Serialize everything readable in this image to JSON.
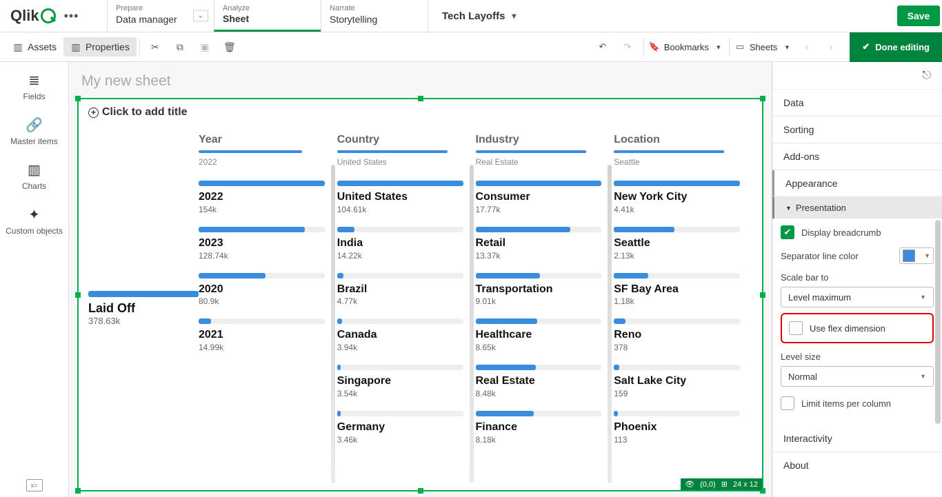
{
  "topbar": {
    "logo": "Qlik",
    "prepare": {
      "sub": "Prepare",
      "main": "Data manager"
    },
    "analyze": {
      "sub": "Analyze",
      "main": "Sheet"
    },
    "narrate": {
      "sub": "Narrate",
      "main": "Storytelling"
    },
    "app_title": "Tech Layoffs",
    "save": "Save"
  },
  "secondbar": {
    "assets": "Assets",
    "properties": "Properties",
    "bookmarks": "Bookmarks",
    "sheets": "Sheets",
    "done": "Done editing"
  },
  "asset_panel": {
    "fields": "Fields",
    "master": "Master items",
    "charts": "Charts",
    "custom": "Custom objects"
  },
  "sheet": {
    "title": "My new sheet",
    "add_title": "Click to add title",
    "status_pos": "(0,0)",
    "status_size": "24 x 12"
  },
  "chart_data": {
    "type": "mekko-tree",
    "root": {
      "label": "Laid Off",
      "value": "378.63k"
    },
    "levels": [
      {
        "header": "Year",
        "breadcrumb": "2022",
        "items": [
          {
            "label": "2022",
            "value": "154k",
            "bold": true,
            "pct": 100
          },
          {
            "label": "2023",
            "value": "128.74k",
            "pct": 84
          },
          {
            "label": "2020",
            "value": "80.9k",
            "pct": 53
          },
          {
            "label": "2021",
            "value": "14.99k",
            "pct": 10
          }
        ]
      },
      {
        "header": "Country",
        "breadcrumb": "United States",
        "items": [
          {
            "label": "United States",
            "value": "104.61k",
            "bold": true,
            "pct": 100
          },
          {
            "label": "India",
            "value": "14.22k",
            "pct": 14
          },
          {
            "label": "Brazil",
            "value": "4.77k",
            "pct": 5
          },
          {
            "label": "Canada",
            "value": "3.94k",
            "pct": 4
          },
          {
            "label": "Singapore",
            "value": "3.54k",
            "pct": 3
          },
          {
            "label": "Germany",
            "value": "3.46k",
            "pct": 3
          }
        ]
      },
      {
        "header": "Industry",
        "breadcrumb": "Real Estate",
        "items": [
          {
            "label": "Consumer",
            "value": "17.77k",
            "pct": 100
          },
          {
            "label": "Retail",
            "value": "13.37k",
            "pct": 75
          },
          {
            "label": "Transportation",
            "value": "9.01k",
            "pct": 51
          },
          {
            "label": "Healthcare",
            "value": "8.65k",
            "pct": 49
          },
          {
            "label": "Real Estate",
            "value": "8.48k",
            "bold": true,
            "pct": 48
          },
          {
            "label": "Finance",
            "value": "8.18k",
            "pct": 46
          }
        ]
      },
      {
        "header": "Location",
        "breadcrumb": "Seattle",
        "items": [
          {
            "label": "New York City",
            "value": "4.41k",
            "pct": 100
          },
          {
            "label": "Seattle",
            "value": "2.13k",
            "bold": true,
            "pct": 48
          },
          {
            "label": "SF Bay Area",
            "value": "1.18k",
            "pct": 27
          },
          {
            "label": "Reno",
            "value": "378",
            "pct": 9
          },
          {
            "label": "Salt Lake City",
            "value": "159",
            "pct": 4
          },
          {
            "label": "Phoenix",
            "value": "113",
            "pct": 3
          }
        ]
      }
    ]
  },
  "props": {
    "data": "Data",
    "sorting": "Sorting",
    "addons": "Add-ons",
    "appearance": "Appearance",
    "presentation": "Presentation",
    "display_breadcrumb": "Display breadcrumb",
    "separator_color": "Separator line color",
    "scale_bar": "Scale bar to",
    "scale_bar_value": "Level maximum",
    "flex_dim": "Use flex dimension",
    "level_size": "Level size",
    "level_size_value": "Normal",
    "limit_items": "Limit items per column",
    "interactivity": "Interactivity",
    "about": "About"
  }
}
